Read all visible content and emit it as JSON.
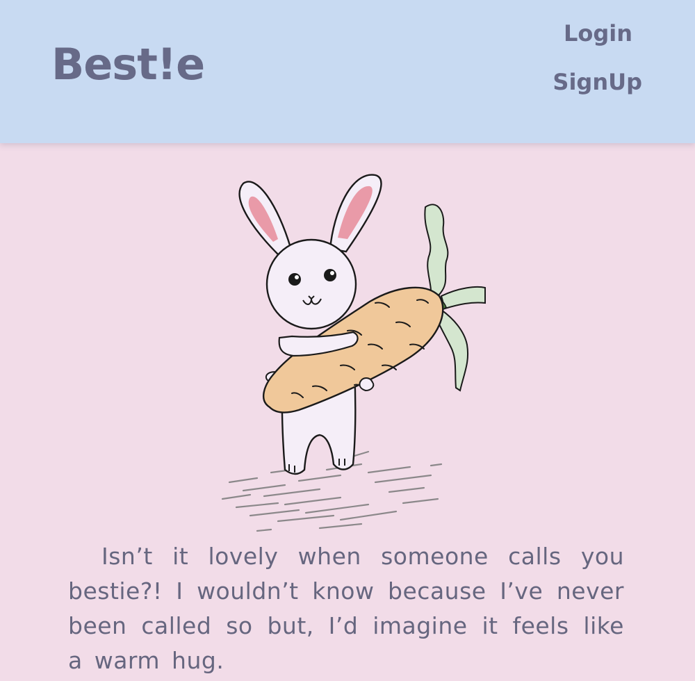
{
  "header": {
    "brand": "Best!e",
    "nav": {
      "login_label": "Login",
      "signup_label": "SignUp"
    }
  },
  "hero": {
    "illustration": "bunny-holding-carrot-icon"
  },
  "main": {
    "intro_text": "Isn’t it lovely when someone calls you bestie?! I wouldn’t know because I’ve never been called so but, I’d imagine it feels like a warm hug."
  },
  "colors": {
    "header_bg": "#c8daf2",
    "page_bg": "#f2dce8",
    "text": "#66667f",
    "carrot": "#f0c89a",
    "ear_inner": "#e99aa8",
    "leaf": "#d4e6cf"
  }
}
